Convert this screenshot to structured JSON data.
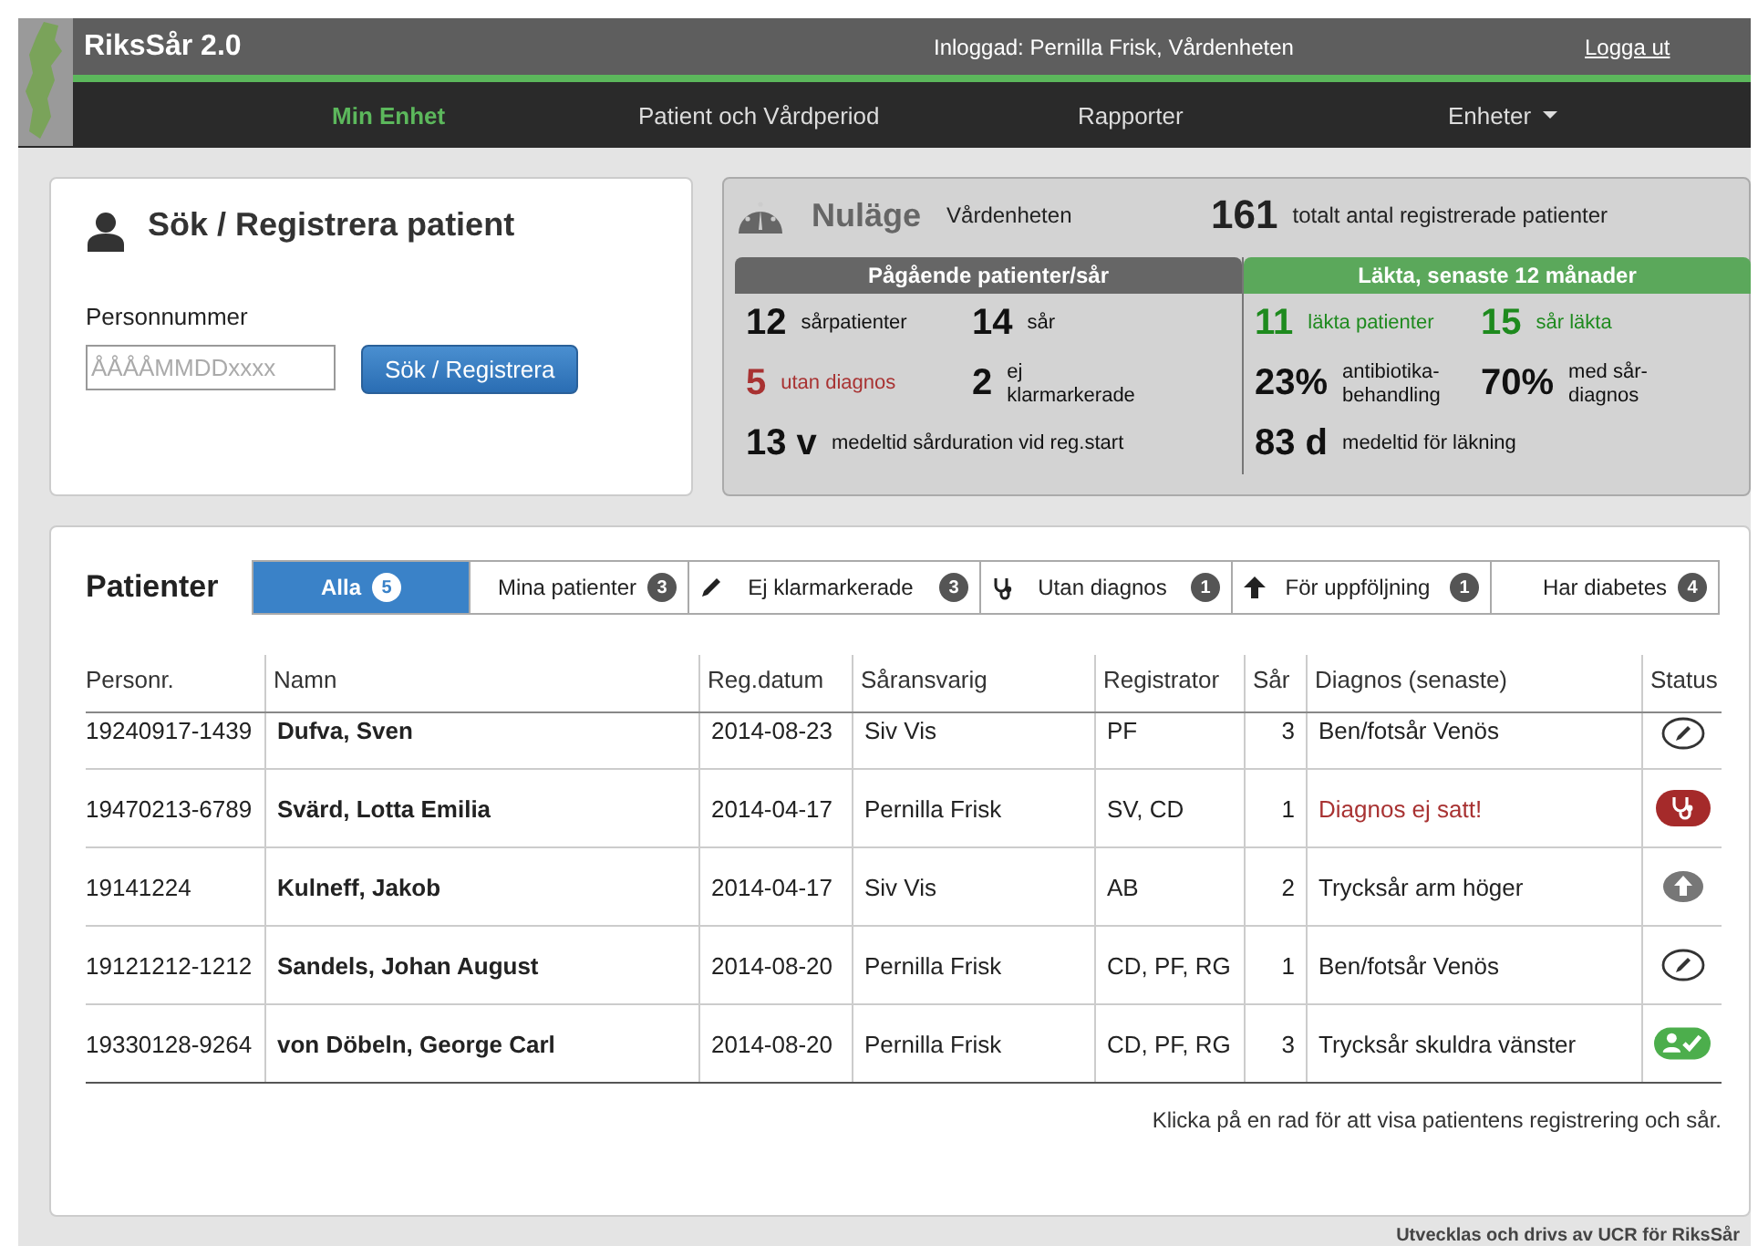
{
  "header": {
    "app_name": "RiksSår 2.0",
    "logged_in": "Inloggad: Pernilla Frisk, Vårdenheten",
    "logout": "Logga ut"
  },
  "nav": [
    {
      "label": "Min Enhet",
      "selected": true,
      "dropdown": false
    },
    {
      "label": "Patient och Vårdperiod",
      "selected": false,
      "dropdown": false
    },
    {
      "label": "Rapporter",
      "selected": false,
      "dropdown": false
    },
    {
      "label": "Enheter",
      "selected": false,
      "dropdown": true
    }
  ],
  "search": {
    "title": "Sök / Registrera patient",
    "label": "Personnummer",
    "placeholder": "ÅÅÅÅMMDDxxxx",
    "button": "Sök / Registrera"
  },
  "status": {
    "title": "Nuläge",
    "unit": "Vårdenheten",
    "total": "161",
    "total_label": "totalt antal registrerade patienter",
    "ongoing": {
      "title": "Pågående patienter/sår",
      "rows": [
        [
          {
            "value": "12",
            "label": "sårpatienter",
            "color": "#111111"
          },
          {
            "value": "14",
            "label": "sår",
            "color": "#111111"
          }
        ],
        [
          {
            "value": "5",
            "label": "utan diagnos",
            "color": "#a83232"
          },
          {
            "value": "2",
            "label": "ej klarmarkerade",
            "color": "#111111"
          }
        ],
        [
          {
            "value": "13 v",
            "label": "medeltid sårduration vid reg.start",
            "color": "#111111"
          }
        ]
      ]
    },
    "healed": {
      "title": "Läkta, senaste 12 månader",
      "rows": [
        [
          {
            "value": "11",
            "label": "läkta patienter",
            "color": "#1e8a1e"
          },
          {
            "value": "15",
            "label": "sår läkta",
            "color": "#1e8a1e"
          }
        ],
        [
          {
            "value": "23%",
            "label": "antibiotika-behandling",
            "color": "#111111"
          },
          {
            "value": "70%",
            "label": "med sår-diagnos",
            "color": "#111111"
          }
        ],
        [
          {
            "value": "83 d",
            "label": "medeltid för läkning",
            "color": "#111111"
          }
        ]
      ]
    }
  },
  "patients": {
    "title": "Patienter",
    "tabs": [
      {
        "label": "Alla",
        "count": "5",
        "selected": true,
        "kind": "none"
      },
      {
        "label": "Mina patienter",
        "count": "3",
        "selected": false,
        "kind": "none"
      },
      {
        "label": "Ej klarmarkerade",
        "count": "3",
        "selected": false,
        "kind": "pencil"
      },
      {
        "label": "Utan diagnos",
        "count": "1",
        "selected": false,
        "kind": "stethoscope"
      },
      {
        "label": "För uppföljning",
        "count": "1",
        "selected": false,
        "kind": "arrow"
      },
      {
        "label": "Har diabetes",
        "count": "4",
        "selected": false,
        "kind": "none"
      }
    ],
    "columns": [
      "Personr.",
      "Namn",
      "Reg.datum",
      "Såransvarig",
      "Registrator",
      "Sår",
      "Diagnos (senaste)",
      "Status"
    ],
    "rows": [
      {
        "personnr": "19240917-1439",
        "name": "Dufva, Sven",
        "date": "2014-08-23",
        "responsible": "Siv Vis",
        "registrator": "PF",
        "wounds": "3",
        "diagnosis": "Ben/fotsår Venös",
        "missing": false,
        "kind": "edit"
      },
      {
        "personnr": "19470213-6789",
        "name": "Svärd, Lotta Emilia",
        "date": "2014-04-17",
        "responsible": "Pernilla Frisk",
        "registrator": "SV, CD",
        "wounds": "1",
        "diagnosis": "Diagnos ej satt!",
        "missing": true,
        "kind": "diagnosis"
      },
      {
        "personnr": "19141224",
        "name": "Kulneff, Jakob",
        "date": "2014-04-17",
        "responsible": "Siv Vis",
        "registrator": "AB",
        "wounds": "2",
        "diagnosis": "Trycksår arm höger",
        "missing": false,
        "kind": "followup"
      },
      {
        "personnr": "19121212-1212",
        "name": "Sandels, Johan August",
        "date": "2014-08-20",
        "responsible": "Pernilla Frisk",
        "registrator": "CD, PF, RG",
        "wounds": "1",
        "diagnosis": "Ben/fotsår Venös",
        "missing": false,
        "kind": "edit"
      },
      {
        "personnr": "19330128-9264",
        "name": "von Döbeln, George Carl",
        "date": "2014-08-20",
        "responsible": "Pernilla Frisk",
        "registrator": "CD, PF, RG",
        "wounds": "3",
        "diagnosis": "Trycksår skuldra vänster",
        "missing": false,
        "kind": "done"
      }
    ],
    "hint": "Klicka på en rad för att visa patientens registrering och sår."
  },
  "footer": "Utvecklas och drivs av UCR för RiksSår"
}
